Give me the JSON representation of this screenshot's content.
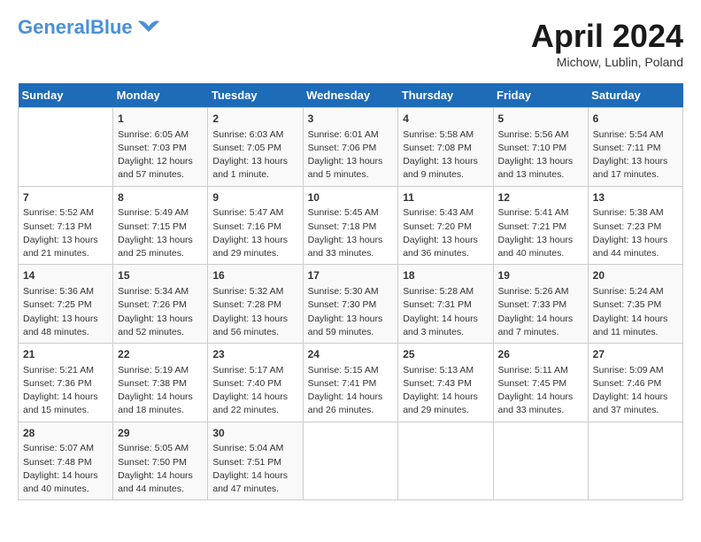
{
  "header": {
    "logo_general": "General",
    "logo_blue": "Blue",
    "month_year": "April 2024",
    "location": "Michow, Lublin, Poland"
  },
  "days_of_week": [
    "Sunday",
    "Monday",
    "Tuesday",
    "Wednesday",
    "Thursday",
    "Friday",
    "Saturday"
  ],
  "weeks": [
    [
      {
        "day": "",
        "content": ""
      },
      {
        "day": "1",
        "content": "Sunrise: 6:05 AM\nSunset: 7:03 PM\nDaylight: 12 hours\nand 57 minutes."
      },
      {
        "day": "2",
        "content": "Sunrise: 6:03 AM\nSunset: 7:05 PM\nDaylight: 13 hours\nand 1 minute."
      },
      {
        "day": "3",
        "content": "Sunrise: 6:01 AM\nSunset: 7:06 PM\nDaylight: 13 hours\nand 5 minutes."
      },
      {
        "day": "4",
        "content": "Sunrise: 5:58 AM\nSunset: 7:08 PM\nDaylight: 13 hours\nand 9 minutes."
      },
      {
        "day": "5",
        "content": "Sunrise: 5:56 AM\nSunset: 7:10 PM\nDaylight: 13 hours\nand 13 minutes."
      },
      {
        "day": "6",
        "content": "Sunrise: 5:54 AM\nSunset: 7:11 PM\nDaylight: 13 hours\nand 17 minutes."
      }
    ],
    [
      {
        "day": "7",
        "content": "Sunrise: 5:52 AM\nSunset: 7:13 PM\nDaylight: 13 hours\nand 21 minutes."
      },
      {
        "day": "8",
        "content": "Sunrise: 5:49 AM\nSunset: 7:15 PM\nDaylight: 13 hours\nand 25 minutes."
      },
      {
        "day": "9",
        "content": "Sunrise: 5:47 AM\nSunset: 7:16 PM\nDaylight: 13 hours\nand 29 minutes."
      },
      {
        "day": "10",
        "content": "Sunrise: 5:45 AM\nSunset: 7:18 PM\nDaylight: 13 hours\nand 33 minutes."
      },
      {
        "day": "11",
        "content": "Sunrise: 5:43 AM\nSunset: 7:20 PM\nDaylight: 13 hours\nand 36 minutes."
      },
      {
        "day": "12",
        "content": "Sunrise: 5:41 AM\nSunset: 7:21 PM\nDaylight: 13 hours\nand 40 minutes."
      },
      {
        "day": "13",
        "content": "Sunrise: 5:38 AM\nSunset: 7:23 PM\nDaylight: 13 hours\nand 44 minutes."
      }
    ],
    [
      {
        "day": "14",
        "content": "Sunrise: 5:36 AM\nSunset: 7:25 PM\nDaylight: 13 hours\nand 48 minutes."
      },
      {
        "day": "15",
        "content": "Sunrise: 5:34 AM\nSunset: 7:26 PM\nDaylight: 13 hours\nand 52 minutes."
      },
      {
        "day": "16",
        "content": "Sunrise: 5:32 AM\nSunset: 7:28 PM\nDaylight: 13 hours\nand 56 minutes."
      },
      {
        "day": "17",
        "content": "Sunrise: 5:30 AM\nSunset: 7:30 PM\nDaylight: 13 hours\nand 59 minutes."
      },
      {
        "day": "18",
        "content": "Sunrise: 5:28 AM\nSunset: 7:31 PM\nDaylight: 14 hours\nand 3 minutes."
      },
      {
        "day": "19",
        "content": "Sunrise: 5:26 AM\nSunset: 7:33 PM\nDaylight: 14 hours\nand 7 minutes."
      },
      {
        "day": "20",
        "content": "Sunrise: 5:24 AM\nSunset: 7:35 PM\nDaylight: 14 hours\nand 11 minutes."
      }
    ],
    [
      {
        "day": "21",
        "content": "Sunrise: 5:21 AM\nSunset: 7:36 PM\nDaylight: 14 hours\nand 15 minutes."
      },
      {
        "day": "22",
        "content": "Sunrise: 5:19 AM\nSunset: 7:38 PM\nDaylight: 14 hours\nand 18 minutes."
      },
      {
        "day": "23",
        "content": "Sunrise: 5:17 AM\nSunset: 7:40 PM\nDaylight: 14 hours\nand 22 minutes."
      },
      {
        "day": "24",
        "content": "Sunrise: 5:15 AM\nSunset: 7:41 PM\nDaylight: 14 hours\nand 26 minutes."
      },
      {
        "day": "25",
        "content": "Sunrise: 5:13 AM\nSunset: 7:43 PM\nDaylight: 14 hours\nand 29 minutes."
      },
      {
        "day": "26",
        "content": "Sunrise: 5:11 AM\nSunset: 7:45 PM\nDaylight: 14 hours\nand 33 minutes."
      },
      {
        "day": "27",
        "content": "Sunrise: 5:09 AM\nSunset: 7:46 PM\nDaylight: 14 hours\nand 37 minutes."
      }
    ],
    [
      {
        "day": "28",
        "content": "Sunrise: 5:07 AM\nSunset: 7:48 PM\nDaylight: 14 hours\nand 40 minutes."
      },
      {
        "day": "29",
        "content": "Sunrise: 5:05 AM\nSunset: 7:50 PM\nDaylight: 14 hours\nand 44 minutes."
      },
      {
        "day": "30",
        "content": "Sunrise: 5:04 AM\nSunset: 7:51 PM\nDaylight: 14 hours\nand 47 minutes."
      },
      {
        "day": "",
        "content": ""
      },
      {
        "day": "",
        "content": ""
      },
      {
        "day": "",
        "content": ""
      },
      {
        "day": "",
        "content": ""
      }
    ]
  ]
}
